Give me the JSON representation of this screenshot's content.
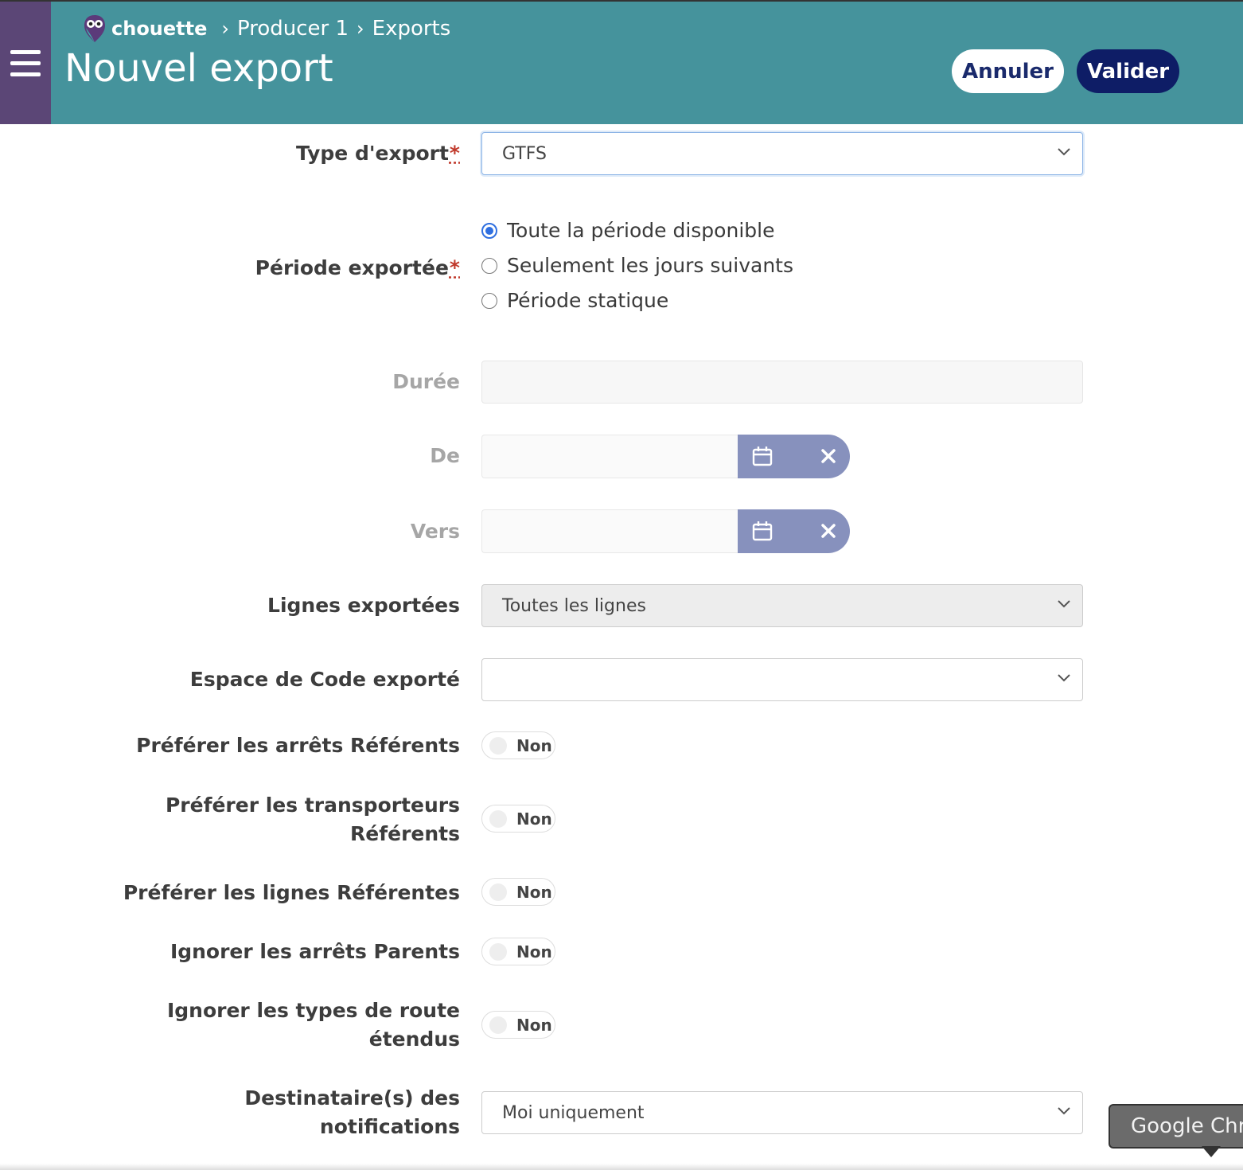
{
  "header": {
    "logo_text": "chouette",
    "breadcrumb": [
      "Producer 1",
      "Exports"
    ],
    "title": "Nouvel export",
    "cancel_label": "Annuler",
    "submit_label": "Valider"
  },
  "form": {
    "export_type": {
      "label": "Type d'export",
      "required_mark": "*",
      "value": "GTFS"
    },
    "period": {
      "label": "Période exportée",
      "required_mark": "*",
      "options": [
        "Toute la période disponible",
        "Seulement les jours suivants",
        "Période statique"
      ],
      "selected_index": 0
    },
    "duration": {
      "label": "Durée",
      "value": ""
    },
    "from": {
      "label": "De",
      "value": ""
    },
    "to": {
      "label": "Vers",
      "value": ""
    },
    "lines": {
      "label": "Lignes exportées",
      "value": "Toutes les lignes"
    },
    "code_space": {
      "label": "Espace de Code exporté",
      "value": ""
    },
    "toggles": [
      {
        "label": "Préférer les arrêts Référents",
        "value": "Non"
      },
      {
        "label_line1": "Préférer les transporteurs",
        "label_line2": "Référents",
        "value": "Non"
      },
      {
        "label": "Préférer les lignes Référentes",
        "value": "Non"
      },
      {
        "label": "Ignorer les arrêts Parents",
        "value": "Non"
      },
      {
        "label_line1": "Ignorer les types de route",
        "label_line2": "étendus",
        "value": "Non"
      }
    ],
    "notifications": {
      "label_line1": "Destinataire(s) des",
      "label_line2": "notifications",
      "value": "Moi uniquement"
    }
  },
  "tooltip": {
    "text": "Google Chr"
  },
  "colors": {
    "sidebar": "#5b4676",
    "header": "#45939c",
    "primary_button": "#0e1d66",
    "date_addon": "#8791bd"
  }
}
